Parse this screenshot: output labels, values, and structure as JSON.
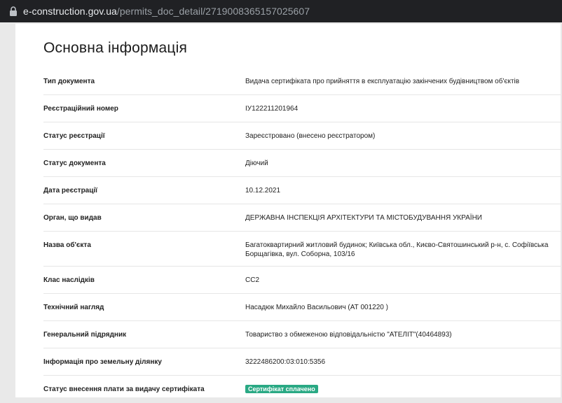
{
  "browser": {
    "url_host": "e-construction.gov.ua",
    "url_path": "/permits_doc_detail/2719008365157025607"
  },
  "section": {
    "title": "Основна інформація"
  },
  "rows": [
    {
      "label": "Тип документа",
      "value": "Видача сертифіката про прийняття в експлуатацію закінчених будівництвом об'єктів"
    },
    {
      "label": "Реєстраційний номер",
      "value": "ІУ122211201964"
    },
    {
      "label": "Статус реєстрації",
      "value": "Зареєстровано (внесено реєстратором)"
    },
    {
      "label": "Статус документа",
      "value": "Діючий"
    },
    {
      "label": "Дата реєстрації",
      "value": "10.12.2021"
    },
    {
      "label": "Орган, що видав",
      "value": "ДЕРЖАВНА ІНСПЕКЦІЯ АРХІТЕКТУРИ ТА МІСТОБУДУВАННЯ УКРАЇНИ"
    },
    {
      "label": "Назва об'єкта",
      "value": "Багатоквартирний житловий будинок; Київська обл., Києво-Святошинський р-н, с. Софіївська Борщагівка, вул. Соборна, 103/16"
    },
    {
      "label": "Клас наслідків",
      "value": "СС2"
    },
    {
      "label": "Технічний нагляд",
      "value": "Насадюк Михайло Васильович (АТ 001220 )"
    },
    {
      "label": "Генеральний підрядник",
      "value": "Товариство з обмеженою відповідальністю \"АТЕЛІТ\"(40464893)"
    },
    {
      "label": "Інформація про земельну ділянку",
      "value": "3222486200:03:010:5356"
    },
    {
      "label": "Статус внесення плати за видачу сертифіката",
      "badge": "Сертифікат сплачено"
    }
  ],
  "colors": {
    "badge_bg": "#2aa984",
    "urlbar_bg": "#202124"
  },
  "icons": {
    "lock": "lock-icon"
  }
}
